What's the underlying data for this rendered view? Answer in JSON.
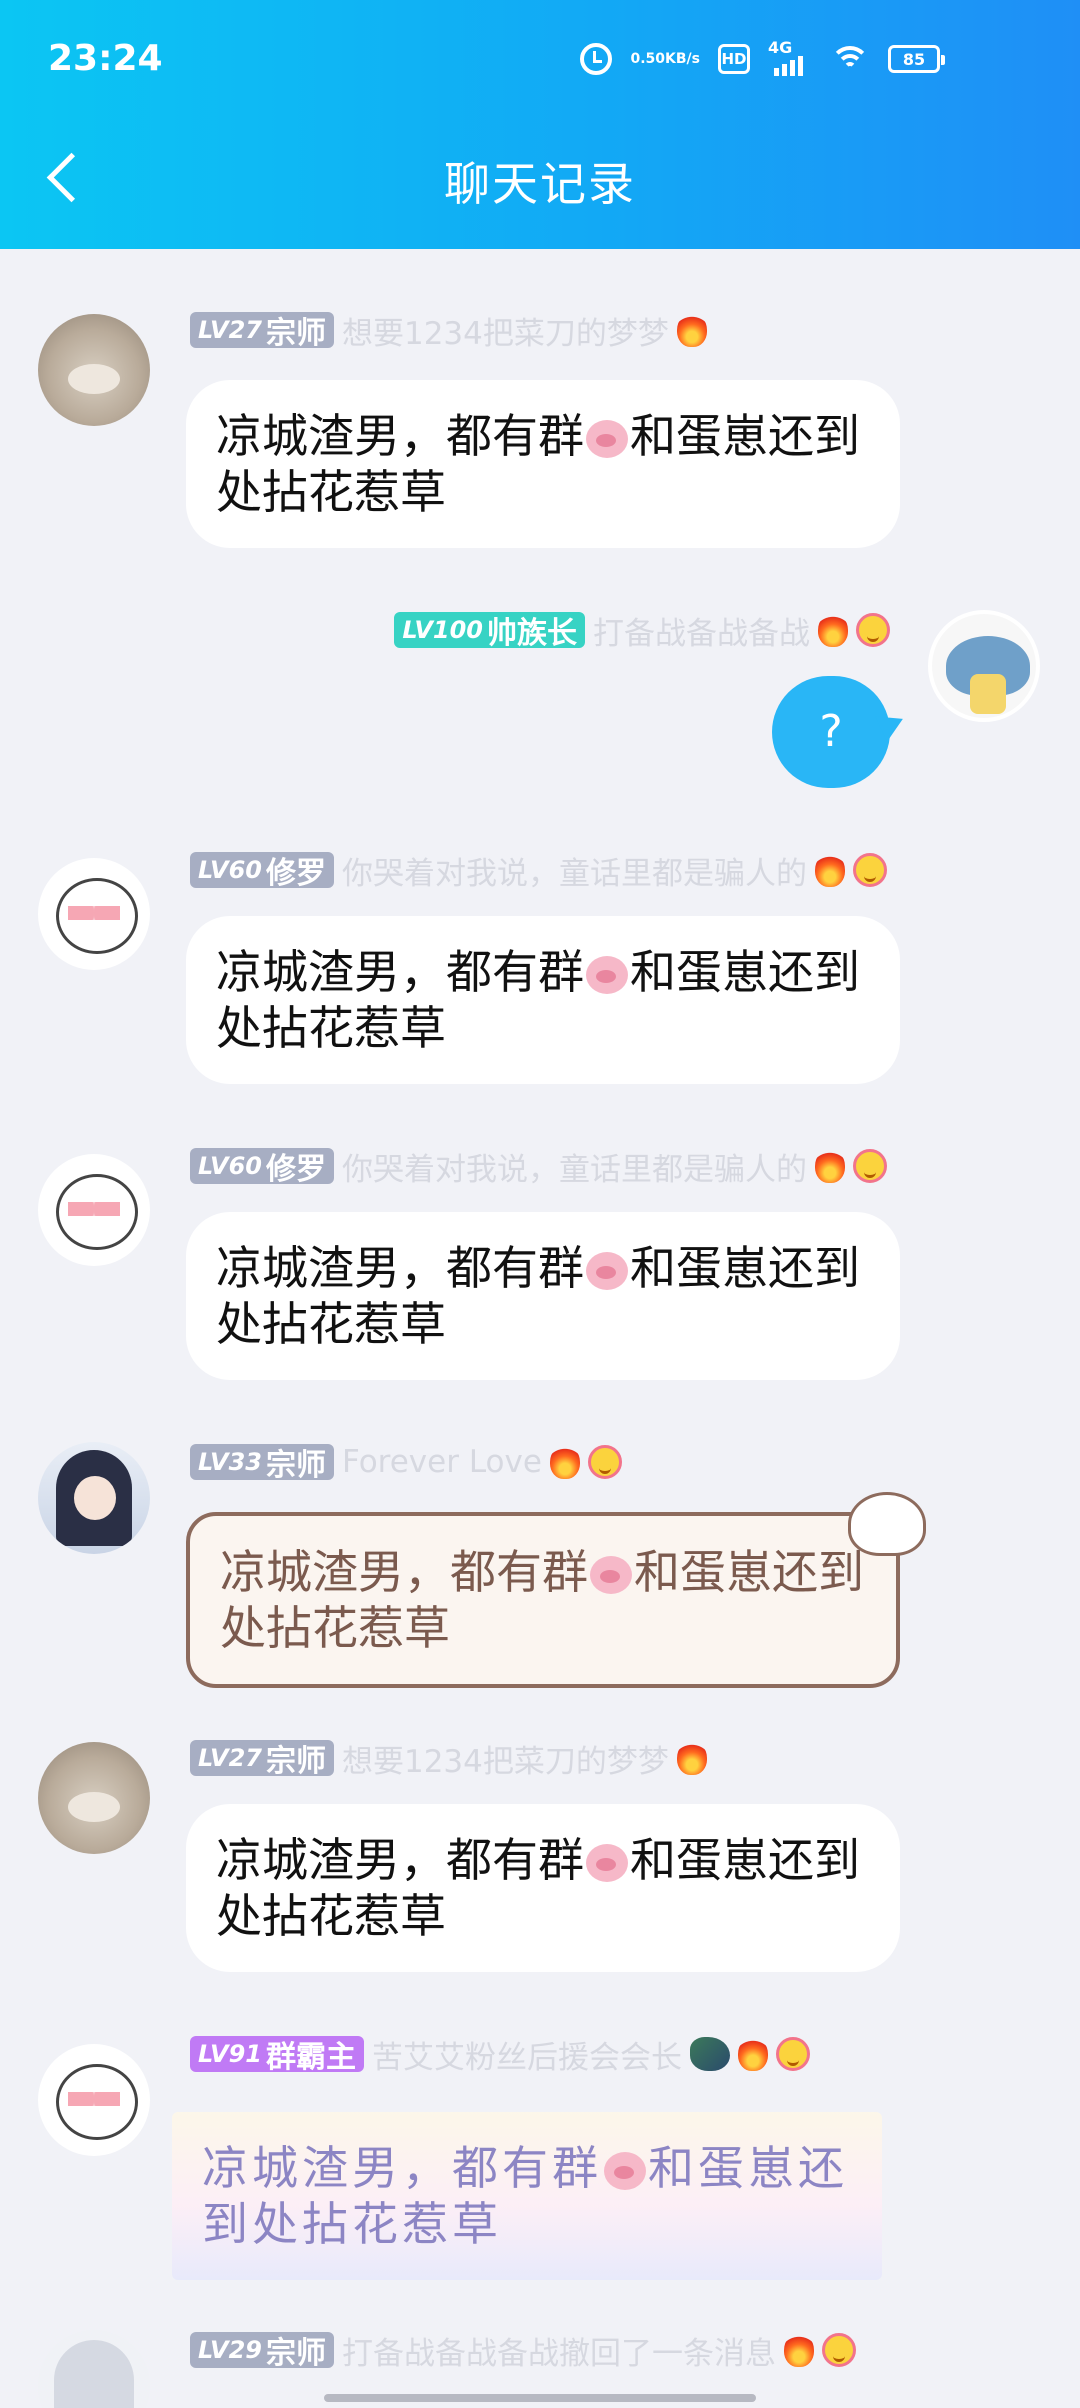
{
  "status_bar": {
    "time": "23:24",
    "speed_value": "0.50",
    "speed_unit": "KB/s",
    "hd": "HD",
    "network": "4G",
    "battery": "85"
  },
  "header": {
    "title": "聊天记录"
  },
  "messages": [
    {
      "level": "LV27",
      "rank": "宗师",
      "nickname": "想要1234把菜刀的梦梦",
      "text_before": "凉城渣男，都有群",
      "text_after": "和蛋崽还到处拈花惹草"
    },
    {
      "level": "LV100",
      "rank": "帅族长",
      "nickname": "打备战备战备战",
      "text": "?"
    },
    {
      "level": "LV60",
      "rank": "修罗",
      "nickname": "你哭着对我说，童话里都是骗人的",
      "text_before": "凉城渣男，都有群",
      "text_after": "和蛋崽还到处拈花惹草"
    },
    {
      "level": "LV60",
      "rank": "修罗",
      "nickname": "你哭着对我说，童话里都是骗人的",
      "text_before": "凉城渣男，都有群",
      "text_after": "和蛋崽还到处拈花惹草"
    },
    {
      "level": "LV33",
      "rank": "宗师",
      "nickname": "Forever Love",
      "text_before": "凉城渣男，都有群",
      "text_after": "和蛋崽还到处拈花惹草"
    },
    {
      "level": "LV27",
      "rank": "宗师",
      "nickname": "想要1234把菜刀的梦梦",
      "text_before": "凉城渣男，都有群",
      "text_after": "和蛋崽还到处拈花惹草"
    },
    {
      "level": "LV91",
      "rank": "群霸主",
      "nickname": "苦艾艾粉丝后援会会长",
      "text_before": "凉城渣男，都有群",
      "text_after": "和蛋崽还到处拈花惹草"
    },
    {
      "level": "LV29",
      "rank": "宗师",
      "nickname": "打备战备战备战撤回了一条消息"
    }
  ]
}
